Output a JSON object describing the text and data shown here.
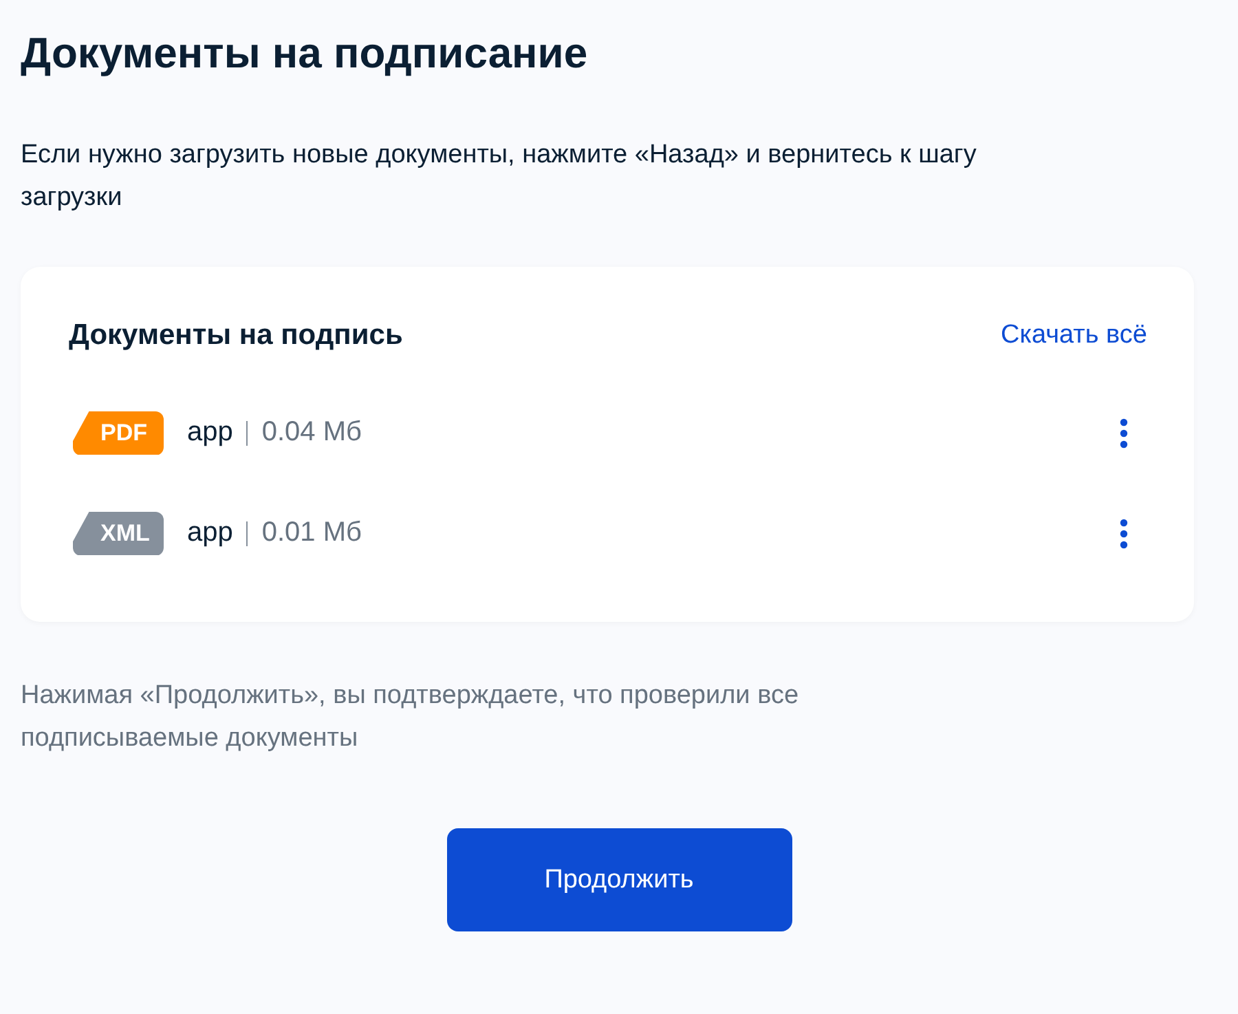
{
  "title": "Документы на подписание",
  "intro": "Если нужно загрузить новые документы, нажмите «Назад» и вернитесь к шагу загрузки",
  "card": {
    "title": "Документы на подпись",
    "download_all": "Скачать всё",
    "files": [
      {
        "type": "PDF",
        "color": "#ff8a00",
        "name": "app",
        "size": "0.04 Мб"
      },
      {
        "type": "XML",
        "color": "#86909c",
        "name": "app",
        "size": "0.01 Мб"
      }
    ]
  },
  "notice": "Нажимая «Продолжить», вы подтверждаете, что проверили все подписываемые документы",
  "continue_button": "Продолжить"
}
